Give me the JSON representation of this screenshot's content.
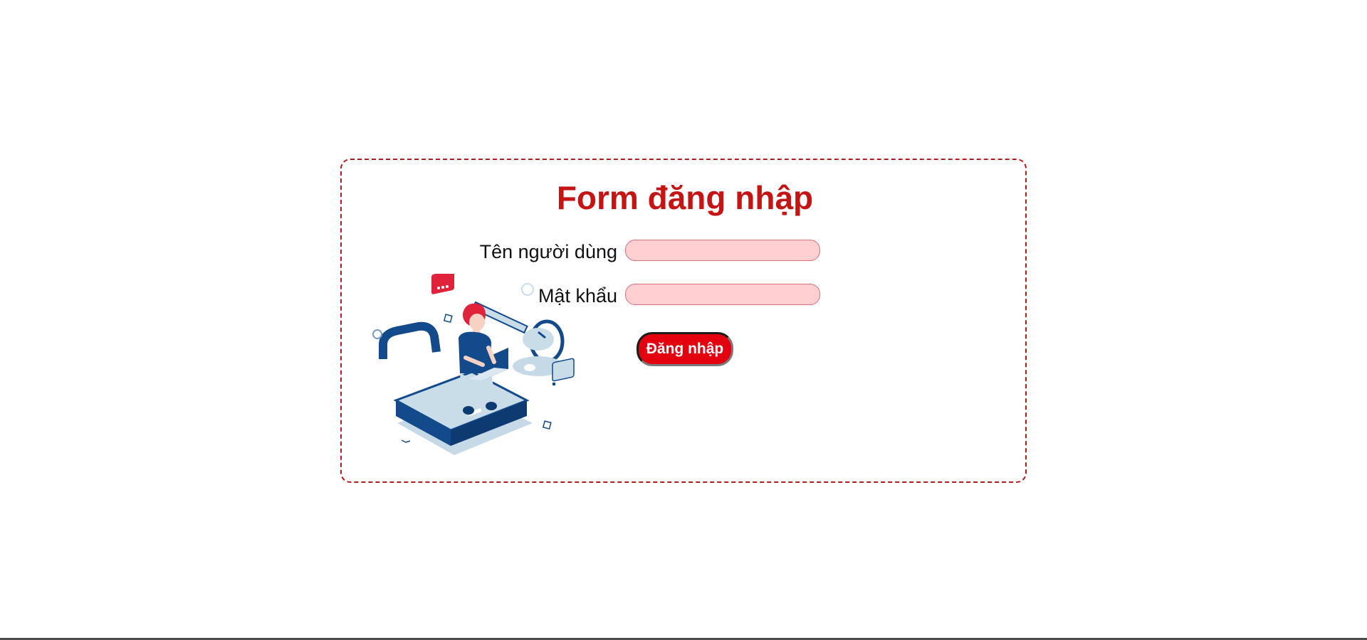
{
  "form": {
    "title": "Form đăng nhập",
    "username_label": "Tên người dùng",
    "username_value": "",
    "password_label": "Mật khẩu",
    "password_value": "",
    "submit_label": "Đăng nhập"
  },
  "colors": {
    "accent": "#c41414",
    "button": "#e3000f",
    "input_bg": "#ffcfd2",
    "border": "#b01d1d",
    "illustration_navy": "#124a8c",
    "illustration_light": "#c9dde9"
  },
  "illustration": {
    "icon": "login-security-illustration-icon"
  }
}
